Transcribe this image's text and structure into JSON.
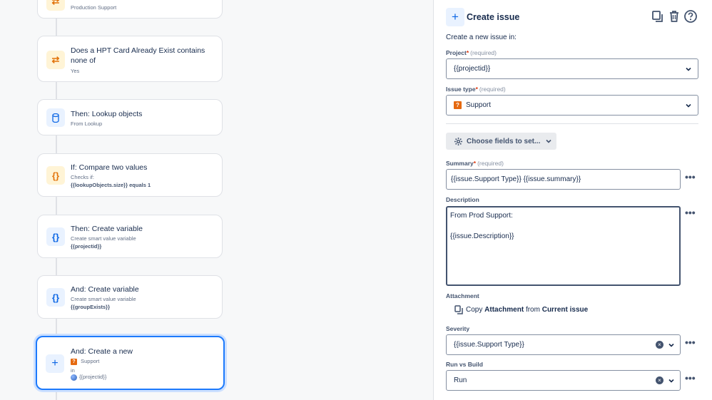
{
  "flow": {
    "cards": [
      {
        "title": "",
        "subtitle": "Production Support"
      },
      {
        "title": "Does a HPT Card Already Exist contains none of",
        "subtitle": "Yes"
      },
      {
        "title": "Then: Lookup objects",
        "subtitle": "From Lookup"
      },
      {
        "title": "If: Compare two values",
        "subtitle": "Checks if:",
        "detail": "{{lookupObjects.size}} equals 1"
      },
      {
        "title": "Then: Create variable",
        "subtitle": "Create smart value variable",
        "detail": "{{projectid}}"
      },
      {
        "title": "And: Create variable",
        "subtitle": "Create smart value variable",
        "detail": "{{groupExists}}"
      },
      {
        "title": "And: Create a new",
        "issue_type": "Support",
        "in_label": "in",
        "project": "{{projectid}}"
      }
    ]
  },
  "panel": {
    "title": "Create issue",
    "intro": "Create a new issue in:",
    "required_text": "(required)",
    "required_mark": "*",
    "project": {
      "label": "Project",
      "value": "{{projectid}}"
    },
    "issue_type": {
      "label": "Issue type",
      "value": "Support"
    },
    "choose_fields": "Choose fields to set...",
    "summary": {
      "label": "Summary",
      "value": "{{issue.Support Type}} {{issue.summary}}"
    },
    "description": {
      "label": "Description",
      "line1": "From Prod Support:",
      "line2": "{{issue.Description}}"
    },
    "attachment": {
      "label": "Attachment",
      "copy": "Copy",
      "what": "Attachment",
      "from": "from",
      "source": "Current issue"
    },
    "severity": {
      "label": "Severity",
      "value": "{{issue.Support Type}}"
    },
    "run_vs_build": {
      "label": "Run vs Build",
      "value": "Run"
    },
    "more_label": "•••"
  },
  "colors": {
    "accent": "#0c66e4",
    "selected_border": "#1d7afc",
    "warning": "#e56910"
  }
}
